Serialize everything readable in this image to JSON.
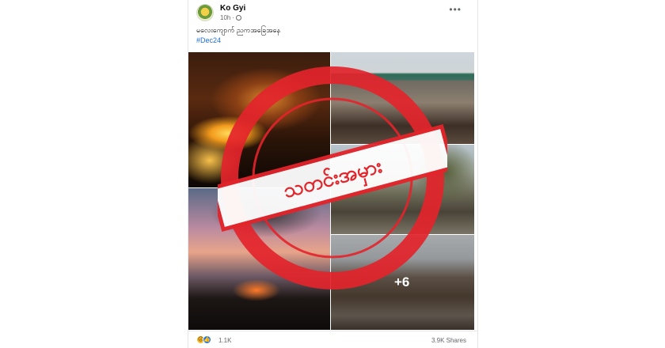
{
  "post": {
    "author": "Ko Gyi",
    "time": "10h",
    "caption": "မလေးကျောက် ညကအခြေအနေ",
    "hashtag": "#Dec24",
    "more_photos": "+6"
  },
  "stamp": {
    "text": "သတင်းအမှား",
    "color": "#e3242b"
  },
  "footer": {
    "reaction_count": "1.1K",
    "shares": "3.9K Shares"
  },
  "icons": {
    "menu": "more-options-icon",
    "privacy": "globe-icon",
    "reactions": [
      "sad-reaction-icon",
      "like-reaction-icon"
    ]
  }
}
